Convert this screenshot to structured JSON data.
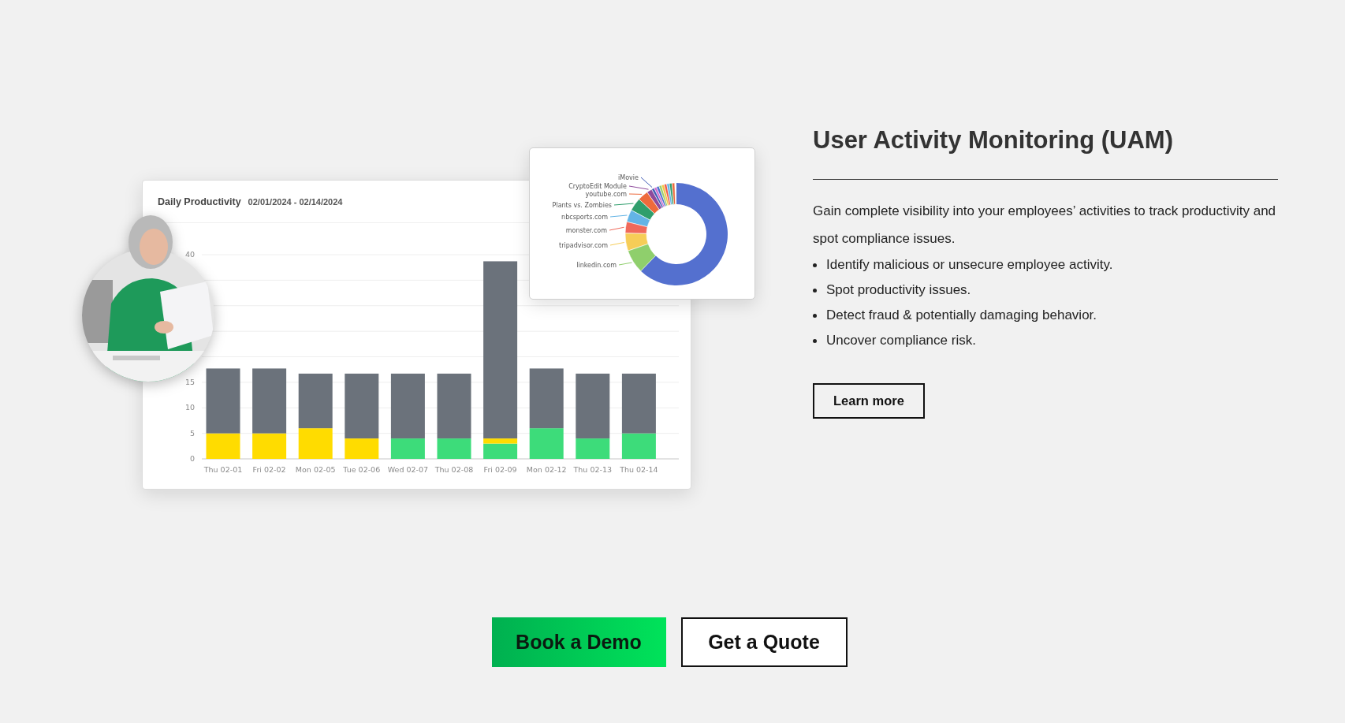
{
  "illustration": {
    "productivity_card": {
      "title": "Daily Productivity",
      "date_range": "02/01/2024 - 02/14/2024",
      "chart_data": {
        "type": "bar",
        "stacked": true,
        "categories": [
          "Thu 02-01",
          "Fri 02-02",
          "Mon 02-05",
          "Tue 02-06",
          "Wed 02-07",
          "Thu 02-08",
          "Fri 02-09",
          "Mon 02-12",
          "Thu 02-13",
          "Thu 02-14"
        ],
        "series": [
          {
            "color": "#3ddc7a",
            "values": [
              0,
              0,
              0,
              0,
              4,
              4,
              3,
              6,
              4,
              5
            ]
          },
          {
            "color": "#ffdc00",
            "values": [
              5,
              5,
              6,
              4,
              0,
              0,
              1,
              0,
              0,
              0
            ]
          },
          {
            "color": "#6b727b",
            "values": [
              12.7,
              12.7,
              10.7,
              12.7,
              12.7,
              12.7,
              34.7,
              11.7,
              12.7,
              11.7
            ]
          }
        ],
        "grid": true,
        "ylim": [
          0,
          40
        ],
        "yticks": [
          0,
          5,
          10,
          15,
          40
        ]
      }
    },
    "apps_card": {
      "labels": [
        {
          "label": "iMovie",
          "color": "#3f5bb5"
        },
        {
          "label": "CryptoEdit Module",
          "color": "#8e4a9c"
        },
        {
          "label": "youtube.com",
          "color": "#ee6a3c"
        },
        {
          "label": "Plants vs. Zombies",
          "color": "#2f9e6c"
        },
        {
          "label": "nbcsports.com",
          "color": "#63b4e6"
        },
        {
          "label": "monster.com",
          "color": "#f0695a"
        },
        {
          "label": "tripadvisor.com",
          "color": "#f6cd57"
        },
        {
          "label": "linkedin.com",
          "color": "#8fcf6c"
        }
      ]
    }
  },
  "feature": {
    "heading": "User Activity Monitoring (UAM)",
    "intro": "Gain complete visibility into your employees’ activities to track productivity and spot compliance issues.",
    "bullets": [
      "Identify malicious or unsecure employee activity.",
      "Spot productivity issues.",
      "Detect fraud & potentially damaging behavior.",
      "Uncover compliance risk."
    ],
    "button": "Learn more"
  },
  "cta": {
    "primary": "Book a Demo",
    "secondary": "Get a Quote"
  }
}
